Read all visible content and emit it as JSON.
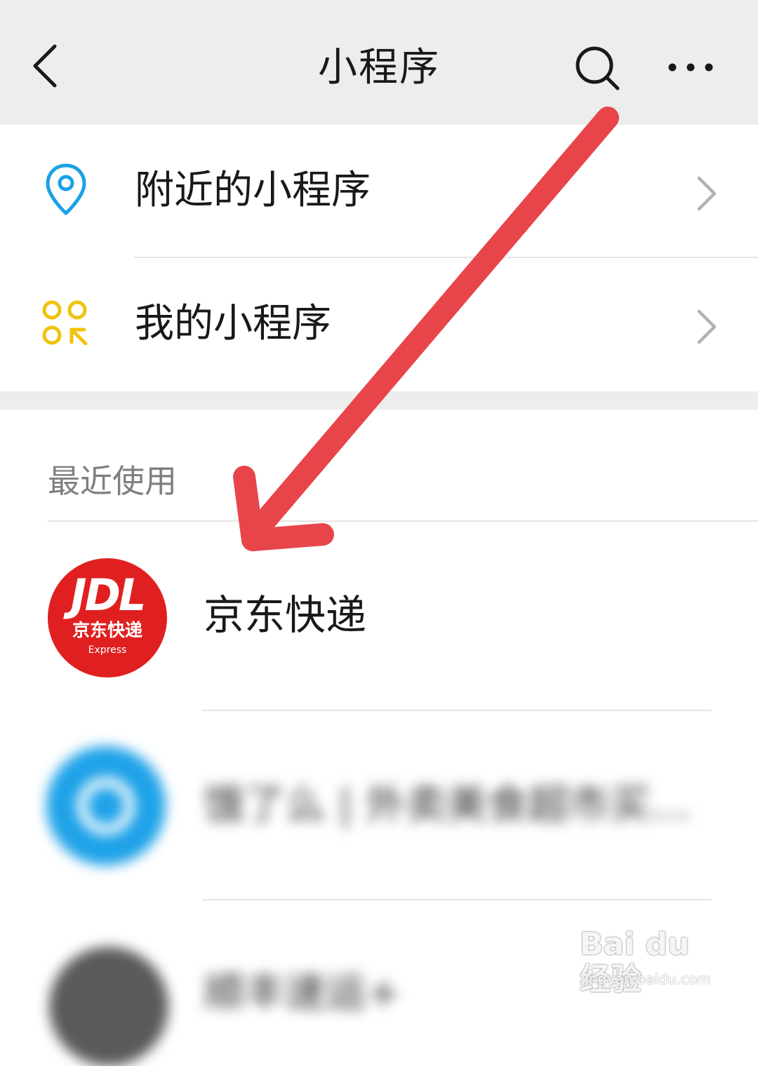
{
  "header": {
    "title": "小程序",
    "back_icon": "chevron-left-icon",
    "search_icon": "search-icon",
    "more_icon": "more-horizontal-icon",
    "background": "#ededed"
  },
  "menu": [
    {
      "label": "附近的小程序",
      "icon": "location-pin-icon",
      "icon_color": "#1aa1e6"
    },
    {
      "label": "我的小程序",
      "icon": "mini-program-icon",
      "icon_color": "#f0c20d"
    }
  ],
  "recent": {
    "section_title": "最近使用",
    "items": [
      {
        "name": "京东快递",
        "logo_mark": "JDL",
        "logo_cn": "京东快递",
        "logo_en": "Express",
        "logo_color": "#e02020",
        "blurred": false
      },
      {
        "name": "饿了么 | 外卖美食超市买菜…",
        "logo_color": "#1ea2e8",
        "blurred": true
      },
      {
        "name": "顺丰速运+",
        "logo_color": "#5a5a5a",
        "blurred": true
      }
    ]
  },
  "annotation": {
    "type": "arrow",
    "color": "#e8454a"
  },
  "watermark": {
    "brand": "Bai du 经验",
    "url": "jingyan.baidu.com"
  }
}
